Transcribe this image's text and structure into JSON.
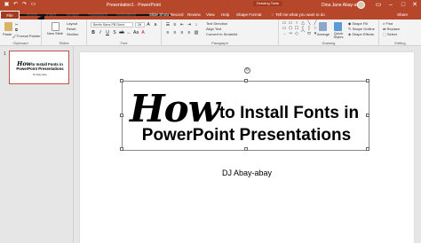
{
  "window": {
    "title": "Presentation1 - PowerPoint",
    "context_label": "Drawing Tools",
    "user": "Dina Jane Abay-abay",
    "accent": "#b7472a"
  },
  "qat": [
    "save-icon",
    "undo-icon",
    "redo-icon",
    "present-icon"
  ],
  "tabs": [
    "File",
    "Home",
    "Insert",
    "Design",
    "Transitions",
    "Animations",
    "Slide Show",
    "Record",
    "Review",
    "View",
    "Help",
    "Shape Format"
  ],
  "tell_me": "Tell me what you want to do",
  "share": "Share",
  "ribbon": {
    "clipboard": {
      "paste": "Paste",
      "format_painter": "Format Painter",
      "label": "Clipboard"
    },
    "slides": {
      "new_slide": "New Slide",
      "layout": "Layout",
      "reset": "Reset",
      "section": "Section",
      "label": "Slides"
    },
    "font": {
      "family": "Berlin Sans FB Demi",
      "size": "28",
      "label": "Font"
    },
    "paragraph": {
      "text_direction": "Text Direction",
      "align_text": "Align Text",
      "convert_smartart": "Convert to SmartArt",
      "label": "Paragraph"
    },
    "drawing": {
      "arrange": "Arrange",
      "quick_styles": "Quick Styles",
      "shape_fill": "Shape Fill",
      "shape_outline": "Shape Outline",
      "shape_effects": "Shape Effects",
      "label": "Drawing"
    },
    "editing": {
      "find": "Find",
      "replace": "Replace",
      "select": "Select",
      "label": "Editing"
    }
  },
  "thumbnail": {
    "number": "1",
    "line1_script": "How",
    "line1_rest": "to Install Fonts in",
    "line2": "PowerPoint Presentations",
    "line3": "DJ Abay-abay"
  },
  "slide": {
    "title_script": "How",
    "title_rest": "to Install Fonts in",
    "title_line2": "PowerPoint Presentations",
    "subtitle": "DJ Abay-abay"
  }
}
